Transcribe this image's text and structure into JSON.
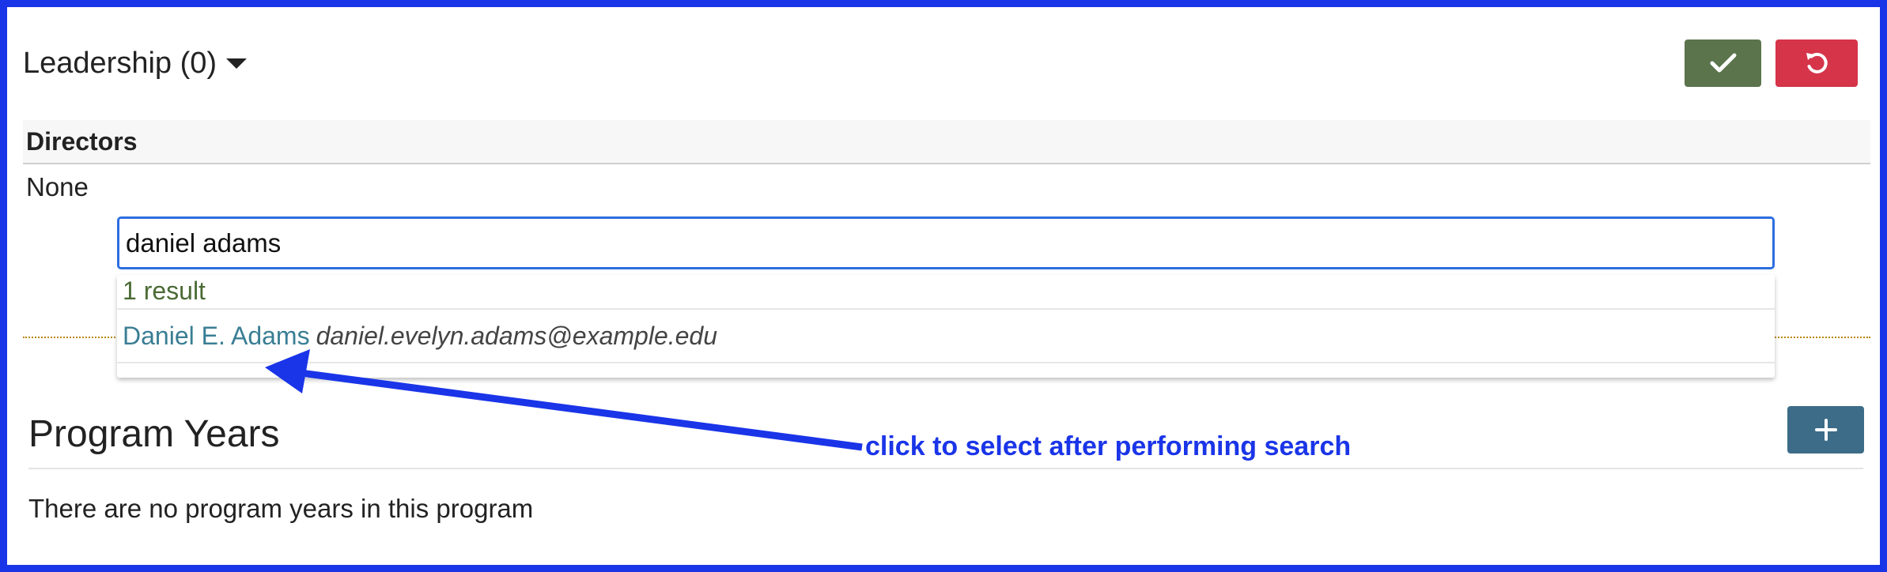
{
  "leadership": {
    "title": "Leadership (0)",
    "caret_icon": "caret-down-icon"
  },
  "toolbar": {
    "save_icon": "check-icon",
    "cancel_icon": "undo-icon",
    "save_color": "#5b744c",
    "cancel_color": "#d53449"
  },
  "directors": {
    "header": "Directors",
    "value": "None"
  },
  "search": {
    "value": "daniel adams"
  },
  "results": {
    "count": "1 result",
    "items": [
      {
        "name": "Daniel E. Adams",
        "email": "daniel.evelyn.adams@example.edu"
      }
    ]
  },
  "program_years": {
    "title": "Program Years",
    "empty_message": "There are no program years in this program",
    "add_icon": "plus-icon"
  },
  "annotation": {
    "text": "click to select after performing search",
    "color": "#1a35e8"
  }
}
